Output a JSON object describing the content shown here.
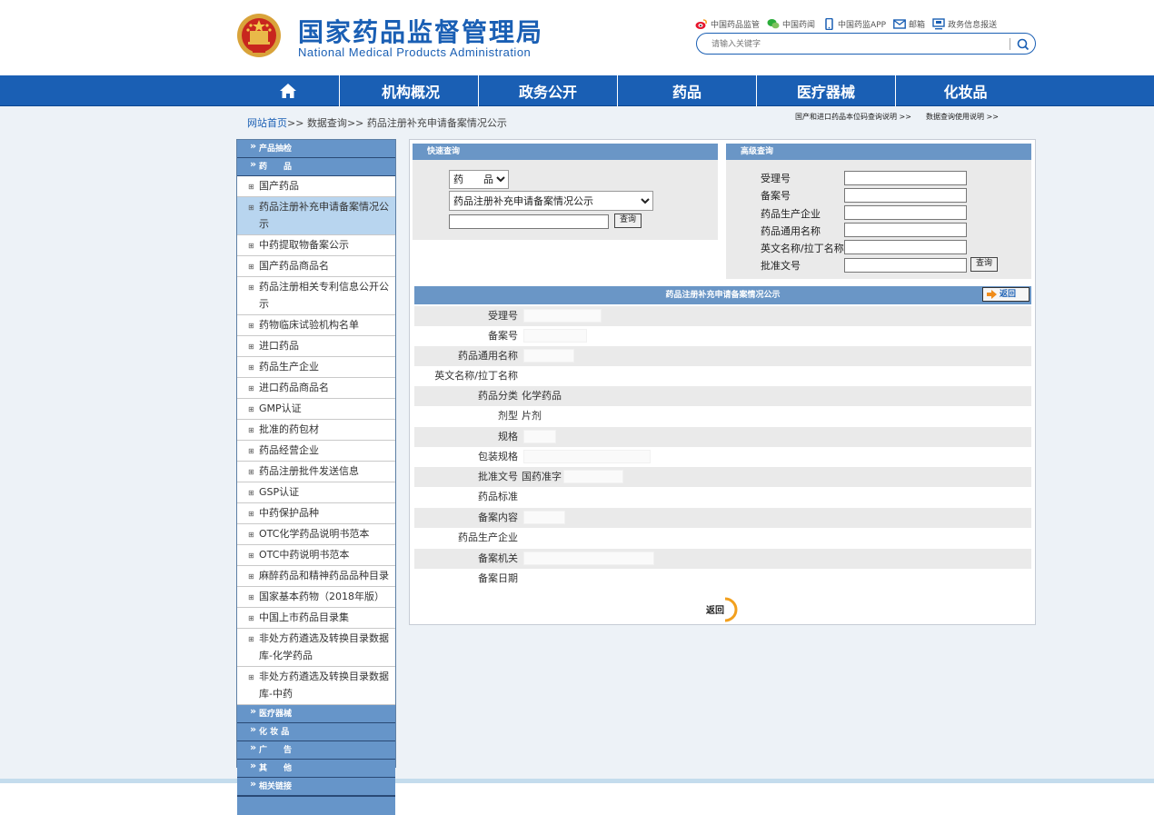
{
  "site": {
    "name_cn": "国家药品监督管理局",
    "name_en": "National Medical Products Administration"
  },
  "top_links": [
    {
      "icon": "weibo-icon",
      "label": "中国药品监管"
    },
    {
      "icon": "wechat-icon",
      "label": "中国药闻"
    },
    {
      "icon": "phone-icon",
      "label": "中国药监APP"
    },
    {
      "icon": "mail-icon",
      "label": "邮箱"
    },
    {
      "icon": "monitor-icon",
      "label": "政务信息报送"
    }
  ],
  "search": {
    "placeholder": "请输入关键字"
  },
  "nav": [
    "机构概况",
    "政务公开",
    "药品",
    "医疗器械",
    "化妆品"
  ],
  "breadcrumb": {
    "home": "网站首页",
    "sep": ">>",
    "data_query": "数据查询",
    "current": "药品注册补充申请备案情况公示"
  },
  "help_links": [
    "国产和进口药品本位码查询说明 >>",
    "数据查询使用说明 >>"
  ],
  "sidebar": {
    "cat_top": [
      "产品抽检",
      "药　　品"
    ],
    "items": [
      "国产药品",
      "药品注册补充申请备案情况公示",
      "中药提取物备案公示",
      "国产药品商品名",
      "药品注册相关专利信息公开公示",
      "药物临床试验机构名单",
      "进口药品",
      "药品生产企业",
      "进口药品商品名",
      "GMP认证",
      "批准的药包材",
      "药品经营企业",
      "药品注册批件发送信息",
      "GSP认证",
      "中药保护品种",
      "OTC化学药品说明书范本",
      "OTC中药说明书范本",
      "麻醉药品和精神药品品种目录",
      "国家基本药物（2018年版）",
      "中国上市药品目录集",
      "非处方药遴选及转换目录数据库-化学药品",
      "非处方药遴选及转换目录数据库-中药"
    ],
    "cat_bottom": [
      "医疗器械",
      "化 妆 品",
      "广　　告",
      "其　　他",
      "相关链接"
    ]
  },
  "quick_query": {
    "title": "快速查询",
    "category_value": "药　　品",
    "table_value": "药品注册补充申请备案情况公示",
    "button": "查询"
  },
  "advanced_query": {
    "title": "高级查询",
    "fields": [
      "受理号",
      "备案号",
      "药品生产企业",
      "药品通用名称",
      "英文名称/拉丁名称",
      "批准文号"
    ],
    "button": "查询"
  },
  "detail": {
    "title": "药品注册补充申请备案情况公示",
    "back_label": "返回",
    "rows": [
      {
        "label": "受理号",
        "value": ""
      },
      {
        "label": "备案号",
        "value": ""
      },
      {
        "label": "药品通用名称",
        "value": ""
      },
      {
        "label": "英文名称/拉丁名称",
        "value": ""
      },
      {
        "label": "药品分类",
        "value": "化学药品"
      },
      {
        "label": "剂型",
        "value": "片剂"
      },
      {
        "label": "规格",
        "value": ""
      },
      {
        "label": "包装规格",
        "value": ""
      },
      {
        "label": "批准文号",
        "value": "国药准字"
      },
      {
        "label": "药品标准",
        "value": ""
      },
      {
        "label": "备案内容",
        "value": ""
      },
      {
        "label": "药品生产企业",
        "value": ""
      },
      {
        "label": "备案机关",
        "value": ""
      },
      {
        "label": "备案日期",
        "value": ""
      }
    ],
    "bottom_back_label": "返回"
  },
  "colors": {
    "brand_blue": "#1a5fb4",
    "section_blue": "#6a96c6",
    "sidebar_cat": "#6695c9",
    "active_item": "#b8d5ef"
  }
}
